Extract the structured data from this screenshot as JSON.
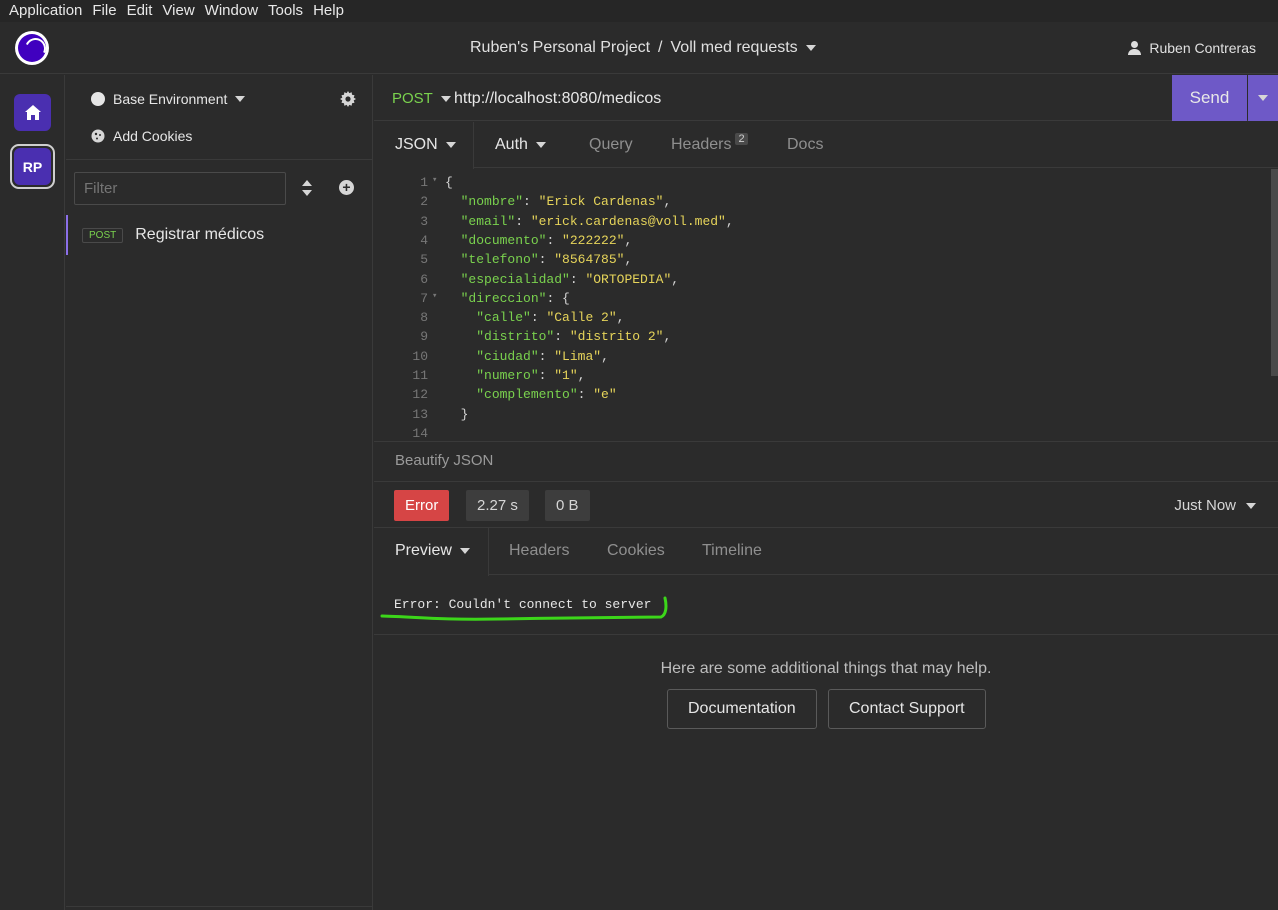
{
  "menu": [
    "Application",
    "File",
    "Edit",
    "View",
    "Window",
    "Tools",
    "Help"
  ],
  "title": {
    "project": "Ruben's Personal Project",
    "separator": "/",
    "collection": "Voll med requests"
  },
  "user": {
    "name": "Ruben Contreras"
  },
  "rail": {
    "project_initials": "RP"
  },
  "sidebar": {
    "environment": "Base Environment",
    "cookies": "Add Cookies",
    "filter_placeholder": "Filter",
    "requests": [
      {
        "method": "POST",
        "name": "Registrar médicos"
      }
    ]
  },
  "request": {
    "method": "POST",
    "url": "http://localhost:8080/medicos",
    "send_label": "Send",
    "tabs": {
      "body": "JSON",
      "auth": "Auth",
      "query": "Query",
      "headers": "Headers",
      "headers_count": "2",
      "docs": "Docs"
    }
  },
  "body_lines": [
    {
      "n": "1",
      "fold": true,
      "parts": [
        [
          "p",
          "{"
        ]
      ]
    },
    {
      "n": "2",
      "parts": [
        [
          "p",
          "  "
        ],
        [
          "k",
          "\"nombre\""
        ],
        [
          "p",
          ": "
        ],
        [
          "s",
          "\"Erick Cardenas\""
        ],
        [
          "p",
          ","
        ]
      ]
    },
    {
      "n": "3",
      "parts": [
        [
          "p",
          "  "
        ],
        [
          "k",
          "\"email\""
        ],
        [
          "p",
          ": "
        ],
        [
          "s",
          "\"erick.cardenas@voll.med\""
        ],
        [
          "p",
          ","
        ]
      ]
    },
    {
      "n": "4",
      "parts": [
        [
          "p",
          "  "
        ],
        [
          "k",
          "\"documento\""
        ],
        [
          "p",
          ": "
        ],
        [
          "s",
          "\"222222\""
        ],
        [
          "p",
          ","
        ]
      ]
    },
    {
      "n": "5",
      "parts": [
        [
          "p",
          "  "
        ],
        [
          "k",
          "\"telefono\""
        ],
        [
          "p",
          ": "
        ],
        [
          "s",
          "\"8564785\""
        ],
        [
          "p",
          ","
        ]
      ]
    },
    {
      "n": "6",
      "parts": [
        [
          "p",
          "  "
        ],
        [
          "k",
          "\"especialidad\""
        ],
        [
          "p",
          ": "
        ],
        [
          "s",
          "\"ORTOPEDIA\""
        ],
        [
          "p",
          ","
        ]
      ]
    },
    {
      "n": "7",
      "fold": true,
      "parts": [
        [
          "p",
          "  "
        ],
        [
          "k",
          "\"direccion\""
        ],
        [
          "p",
          ": {"
        ]
      ]
    },
    {
      "n": "8",
      "parts": [
        [
          "p",
          "    "
        ],
        [
          "k",
          "\"calle\""
        ],
        [
          "p",
          ": "
        ],
        [
          "s",
          "\"Calle 2\""
        ],
        [
          "p",
          ","
        ]
      ]
    },
    {
      "n": "9",
      "parts": [
        [
          "p",
          "    "
        ],
        [
          "k",
          "\"distrito\""
        ],
        [
          "p",
          ": "
        ],
        [
          "s",
          "\"distrito 2\""
        ],
        [
          "p",
          ","
        ]
      ]
    },
    {
      "n": "10",
      "parts": [
        [
          "p",
          "    "
        ],
        [
          "k",
          "\"ciudad\""
        ],
        [
          "p",
          ": "
        ],
        [
          "s",
          "\"Lima\""
        ],
        [
          "p",
          ","
        ]
      ]
    },
    {
      "n": "11",
      "parts": [
        [
          "p",
          "    "
        ],
        [
          "k",
          "\"numero\""
        ],
        [
          "p",
          ": "
        ],
        [
          "s",
          "\"1\""
        ],
        [
          "p",
          ","
        ]
      ]
    },
    {
      "n": "12",
      "parts": [
        [
          "p",
          "    "
        ],
        [
          "k",
          "\"complemento\""
        ],
        [
          "p",
          ": "
        ],
        [
          "s",
          "\"e\""
        ]
      ]
    },
    {
      "n": "13",
      "parts": [
        [
          "p",
          "  }"
        ]
      ]
    },
    {
      "n": "14",
      "parts": []
    }
  ],
  "beautify_label": "Beautify JSON",
  "response": {
    "status": "Error",
    "time": "2.27 s",
    "size": "0 B",
    "when": "Just Now",
    "tabs": {
      "preview": "Preview",
      "headers": "Headers",
      "cookies": "Cookies",
      "timeline": "Timeline"
    },
    "error_message": "Error: Couldn't connect to server",
    "help_text": "Here are some additional things that may help.",
    "documentation_label": "Documentation",
    "support_label": "Contact Support"
  },
  "colors": {
    "accent": "#6e59c7",
    "method_green": "#7ad24e",
    "string_yellow": "#e6d45a",
    "error_red": "#d64545",
    "annotation_green": "#3cd61a"
  },
  "icons": [
    "home-icon",
    "gear-icon",
    "cookie-icon",
    "sort-icon",
    "plus-icon",
    "user-icon",
    "caret-down-icon"
  ]
}
